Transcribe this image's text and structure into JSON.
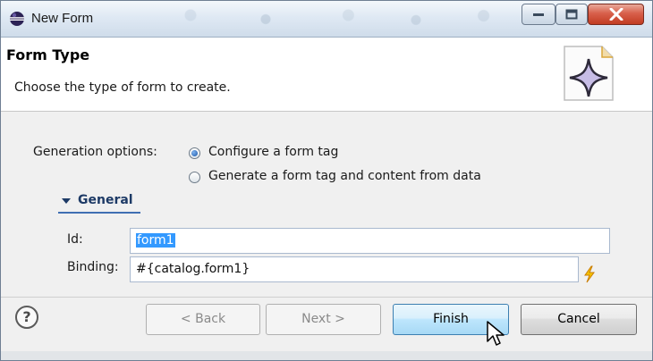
{
  "window": {
    "title": "New Form",
    "icon": "eclipse-icon",
    "controls": {
      "minimize": "minimize-icon",
      "maximize": "maximize-icon",
      "close": "close-icon"
    }
  },
  "header": {
    "title": "Form Type",
    "description": "Choose the type of form to create.",
    "icon": "wizard-star-icon"
  },
  "generation": {
    "label": "Generation options:",
    "options": [
      {
        "label": "Configure a form tag",
        "selected": true
      },
      {
        "label": "Generate a form tag and content from data",
        "selected": false
      }
    ]
  },
  "general": {
    "title": "General",
    "expanded": true,
    "id_label": "Id:",
    "id_value": "form1",
    "binding_label": "Binding:",
    "binding_value": "#{catalog.form1}",
    "binding_icon": "lightning-bolt-icon"
  },
  "footer": {
    "help_icon": "help-icon",
    "back": "< Back",
    "next": "Next >",
    "finish": "Finish",
    "cancel": "Cancel"
  },
  "colors": {
    "accent": "#3f6fb3",
    "selection": "#3399ff",
    "close": "#c23c22"
  }
}
